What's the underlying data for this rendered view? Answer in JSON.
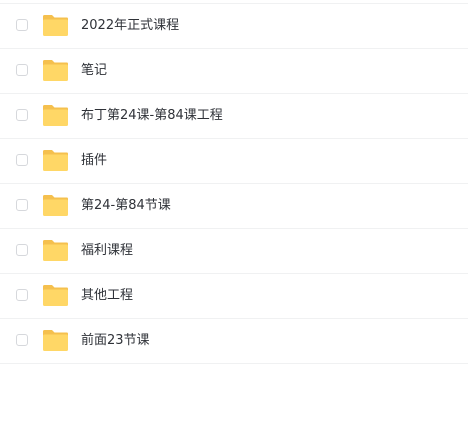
{
  "file_list": {
    "items": [
      {
        "name": "2022年正式课程",
        "icon": "folder-icon",
        "selected": false
      },
      {
        "name": "笔记",
        "icon": "folder-icon",
        "selected": false
      },
      {
        "name": "布丁第24课-第84课工程",
        "icon": "folder-icon",
        "selected": false
      },
      {
        "name": "插件",
        "icon": "folder-icon",
        "selected": false
      },
      {
        "name": "第24-第84节课",
        "icon": "folder-icon",
        "selected": false
      },
      {
        "name": "福利课程",
        "icon": "folder-icon",
        "selected": false
      },
      {
        "name": "其他工程",
        "icon": "folder-icon",
        "selected": false
      },
      {
        "name": "前面23节课",
        "icon": "folder-icon",
        "selected": false
      }
    ]
  },
  "colors": {
    "folder_body": "#ffd766",
    "folder_tab": "#f5c04e",
    "divider": "#f0f1f2",
    "text": "#2f3238",
    "checkbox_border": "#d6d8dc"
  }
}
